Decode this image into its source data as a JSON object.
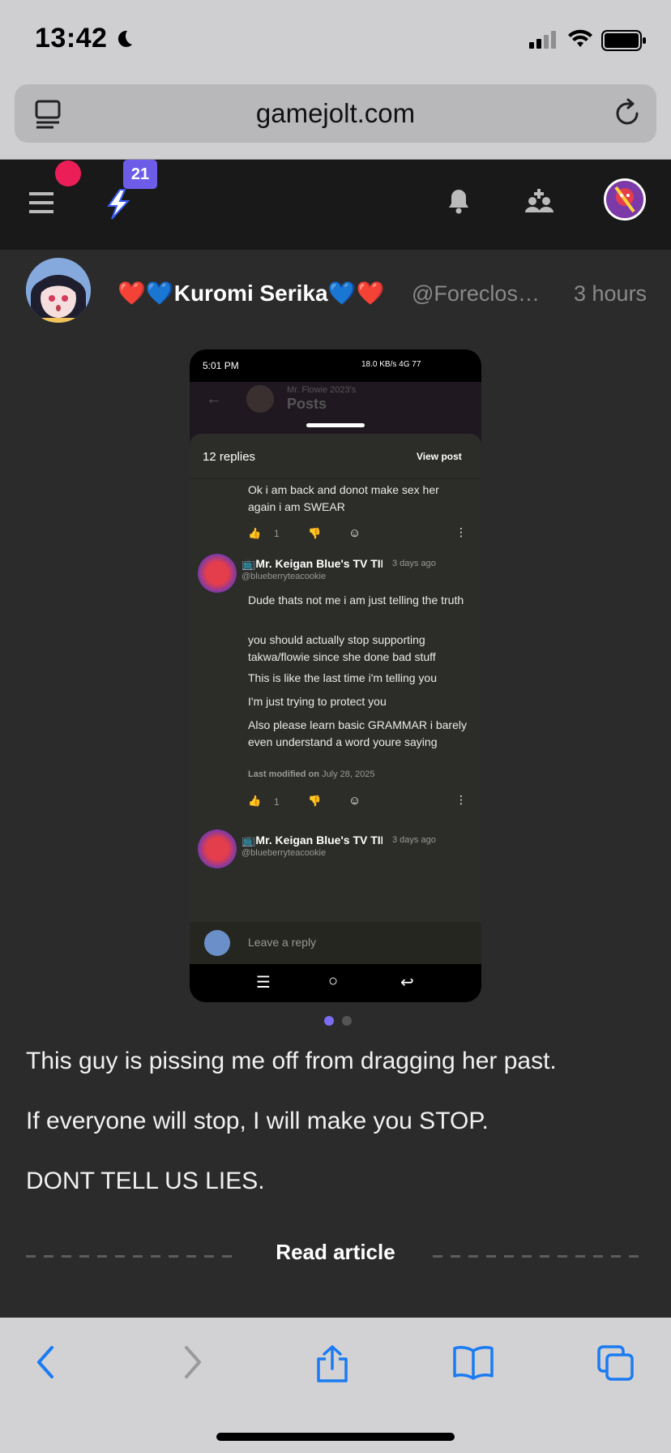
{
  "status_bar": {
    "time": "13:42",
    "moon_icon": "moon-icon",
    "signal_icon": "cellular-signal-icon",
    "wifi_icon": "wifi-icon",
    "battery_icon": "battery-icon"
  },
  "browser": {
    "url": "gamejolt.com",
    "reader_icon": "reader-mode-icon",
    "reload_icon": "reload-icon"
  },
  "gj_nav": {
    "badge_count": "21",
    "accent_color": "#6c5ce7",
    "notification_dot_color": "#ec1e58"
  },
  "post": {
    "author_name": "❤️💙Kuromi Serika💙❤️",
    "author_handle": "@Foreclosu...",
    "time": "3 hours",
    "body": [
      "This guy is pissing me off from dragging her past.",
      "If everyone will stop, I will make you STOP.",
      "DONT TELL US LIES."
    ],
    "read_article": "Read article"
  },
  "screenshot": {
    "status_time": "5:01 PM",
    "status_right": "18.0 KB/s  4G  77",
    "header_title": "Posts",
    "header_sub": "Mr. Flowie 2023's",
    "replies_count": "12 replies",
    "view_post": "View post",
    "reply1_text": "Ok i am back and donot make sex her again i am SWEAR",
    "reply1_likes": "1",
    "reply2_author": "📺Mr. Keigan Blue's TV TIM",
    "reply2_time": "3 days ago",
    "reply2_handle": "@blueberryteacookie",
    "reply2_paragraphs": [
      "Dude thats not me i am just telling the truth",
      "you should actually stop supporting takwa/flowie since she done bad stuff",
      "This is like the last time i'm telling you",
      "I'm just trying to protect you",
      "Also please learn basic GRAMMAR i barely even understand a word youre saying"
    ],
    "last_modified_label": "Last modified on",
    "last_modified_date": "July 28, 2025",
    "reply2_likes": "1",
    "reply3_author": "📺Mr. Keigan Blue's TV TIM",
    "reply3_time": "3 days ago",
    "reply3_handle": "@blueberryteacookie",
    "leave_reply": "Leave a reply"
  },
  "pager": {
    "active_color": "#7c6cf0",
    "inactive_color": "#555555"
  },
  "toolbar": {
    "back": "back-icon",
    "forward": "forward-icon",
    "share": "share-icon",
    "bookmarks": "bookmarks-icon",
    "tabs": "tabs-icon"
  }
}
